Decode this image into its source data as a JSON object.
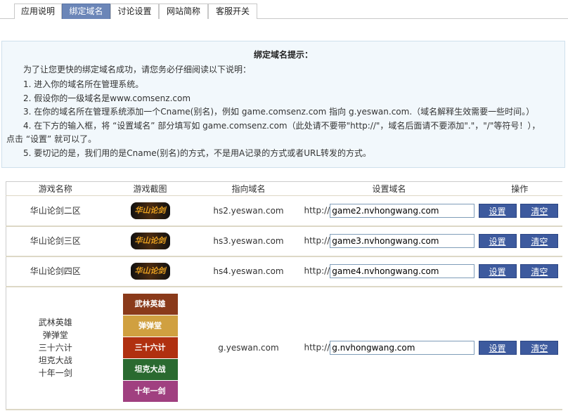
{
  "tabs": [
    "应用说明",
    "绑定域名",
    "讨论设置",
    "网站简称",
    "客服开关"
  ],
  "active_tab": 1,
  "tip": {
    "title": "绑定域名提示：",
    "intro": "为了让您更快的绑定域名成功，请您务必仔细阅读以下说明：",
    "steps": [
      "1. 进入你的域名所在管理系统。",
      "2. 假设你的一级域名是www.comsenz.com",
      "3. 在你的域名所在管理系统添加一个Cname(别名)，例如 game.comsenz.com 指向 g.yeswan.com.（域名解释生效需要一些时间。）",
      "4. 在下方的输入框，将 “设置域名” 部分填写如 game.comsenz.com（此处请不要带\"http://\"，域名后面请不要添加\".\"，\"/\"等符号！），",
      "点击 “设置” 就可以了。",
      "5. 要切记的是，我们用的是Cname(别名)的方式，不是用A记录的方式或者URL转发的方式。"
    ]
  },
  "table": {
    "headers": [
      "游戏名称",
      "游戏截图",
      "指向域名",
      "设置域名",
      "操作"
    ],
    "prefix": "http://",
    "set_label": "设置",
    "clear_label": "清空",
    "rows": [
      {
        "names": [
          "华山论剑二区"
        ],
        "images": [
          "华山论剑"
        ],
        "target": "hs2.yeswan.com",
        "domain": "game2.nvhongwang.com"
      },
      {
        "names": [
          "华山论剑三区"
        ],
        "images": [
          "华山论剑"
        ],
        "target": "hs3.yeswan.com",
        "domain": "game3.nvhongwang.com"
      },
      {
        "names": [
          "华山论剑四区"
        ],
        "images": [
          "华山论剑"
        ],
        "target": "hs4.yeswan.com",
        "domain": "game4.nvhongwang.com"
      },
      {
        "names": [
          "武林英雄",
          "弹弹堂",
          "三十六计",
          "坦克大战",
          "十年一剑"
        ],
        "images": [
          "武林英雄",
          "弹弹堂",
          "三十六计",
          "坦克大战",
          "十年一剑"
        ],
        "target": "g.yeswan.com",
        "domain": "g.nvhongwang.com"
      }
    ]
  }
}
